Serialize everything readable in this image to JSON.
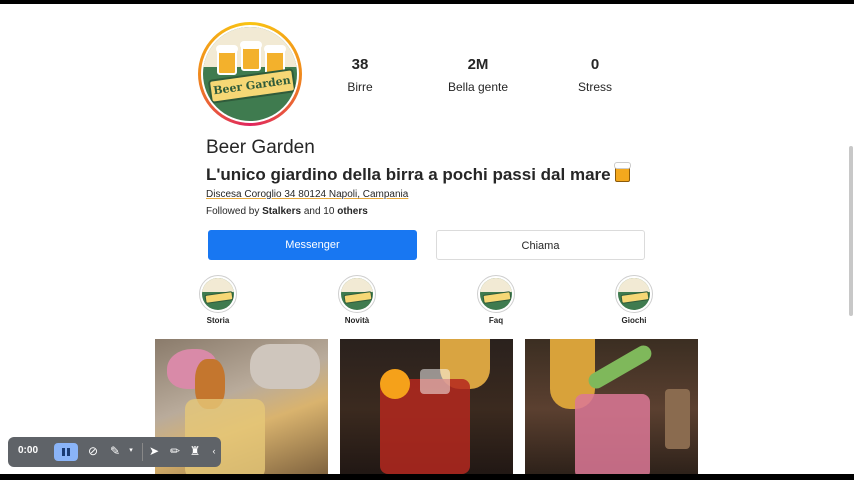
{
  "profile": {
    "logo_text": "Beer Garden",
    "name": "Beer Garden",
    "tagline": "L'unico giardino della birra a pochi passi dal mare",
    "address": "Discesa Coroglio 34 80124 Napoli, Campania",
    "followed_prefix": "Followed by",
    "followed_name": "Stalkers",
    "followed_and": "and 10",
    "followed_others": "others"
  },
  "stats": [
    {
      "value": "38",
      "label": "Birre"
    },
    {
      "value": "2M",
      "label": "Bella gente"
    },
    {
      "value": "0",
      "label": "Stress"
    }
  ],
  "buttons": {
    "messenger": "Messenger",
    "chiama": "Chiama"
  },
  "highlights": [
    {
      "label": "Storia"
    },
    {
      "label": "Novità"
    },
    {
      "label": "Faq"
    },
    {
      "label": "Giochi"
    }
  ],
  "recorder": {
    "time": "0:00"
  },
  "colors": {
    "primary_button": "#1877f2",
    "logo_green": "#3f7b4f",
    "recorder_bg": "#5f6368"
  }
}
